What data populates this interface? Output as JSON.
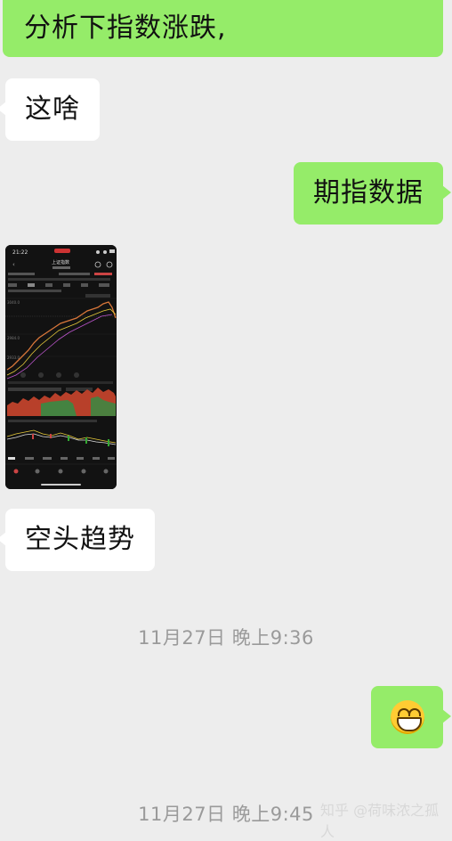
{
  "messages": {
    "top_partial": "分析下指数涨跌,",
    "m1": "这啥",
    "m2": "期指数据",
    "m3": "空头趋势"
  },
  "screenshot": {
    "time": "21:22",
    "title": "上证指数"
  },
  "timestamps": {
    "t1": "11月27日 晚上9:36",
    "t2": "11月27日 晚上9:45"
  },
  "emoji": {
    "name": "grinning-face-icon"
  },
  "watermark": "知乎 @荷味浓之孤人"
}
